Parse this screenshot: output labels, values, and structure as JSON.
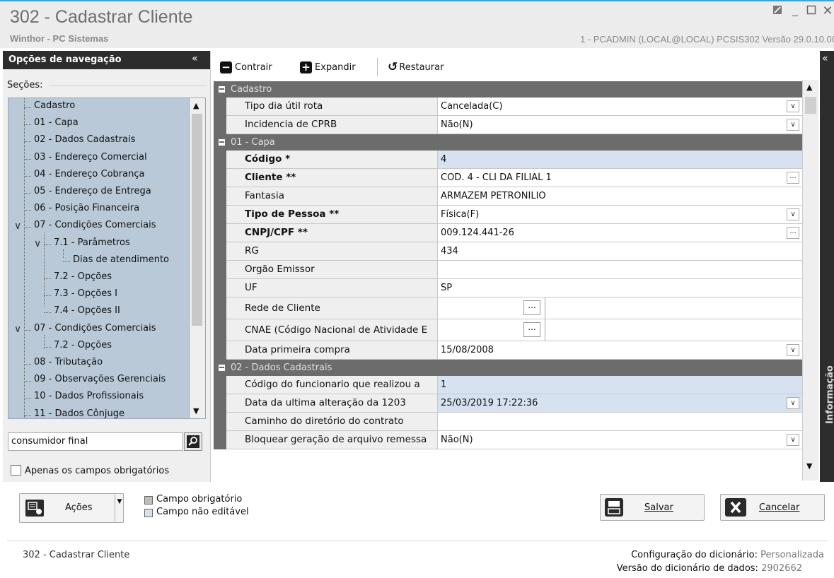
{
  "window": {
    "title": "302 - Cadastrar Cliente",
    "subtitle": "Winthor - PC Sistemas",
    "user_info": "1 - PCADMIN (LOCAL@LOCAL)   PCSIS302  Versão  29.0.10.00"
  },
  "nav": {
    "header": "Opções de navegação",
    "collapse_glyph": "«",
    "sections_label": "Seções:",
    "tree": [
      {
        "label": "Cadastro",
        "level": 0,
        "expander": ""
      },
      {
        "label": "01 - Capa",
        "level": 0,
        "expander": ""
      },
      {
        "label": "02 - Dados Cadastrais",
        "level": 0,
        "expander": ""
      },
      {
        "label": "03 - Endereço Comercial",
        "level": 0,
        "expander": ""
      },
      {
        "label": "04 - Endereço Cobrança",
        "level": 0,
        "expander": ""
      },
      {
        "label": "05 - Endereço de Entrega",
        "level": 0,
        "expander": ""
      },
      {
        "label": "06 - Posição Financeira",
        "level": 0,
        "expander": ""
      },
      {
        "label": "07 - Condições Comerciais",
        "level": 0,
        "expander": "v"
      },
      {
        "label": "7.1 - Parâmetros",
        "level": 1,
        "expander": "v"
      },
      {
        "label": "Dias de atendimento",
        "level": 2,
        "expander": ""
      },
      {
        "label": "7.2 - Opções",
        "level": 1,
        "expander": ""
      },
      {
        "label": "7.3 - Opções I",
        "level": 1,
        "expander": ""
      },
      {
        "label": "7.4 - Opções II",
        "level": 1,
        "expander": ""
      },
      {
        "label": "07 - Condições Comerciais",
        "level": 0,
        "expander": "v"
      },
      {
        "label": "7.2 - Opções",
        "level": 1,
        "expander": ""
      },
      {
        "label": "08 - Tributação",
        "level": 0,
        "expander": ""
      },
      {
        "label": "09 - Observações Gerenciais",
        "level": 0,
        "expander": ""
      },
      {
        "label": "10 - Dados Profissionais",
        "level": 0,
        "expander": ""
      },
      {
        "label": "11 - Dados Cônjuge",
        "level": 0,
        "expander": ""
      }
    ],
    "search_value": "consumidor final",
    "required_only_label": "Apenas os campos obrigatórios"
  },
  "toolbar": {
    "collapse": "Contrair",
    "expand": "Expandir",
    "restore": "Restaurar"
  },
  "right_strip_label": "Informação",
  "grid": [
    {
      "type": "cat",
      "label": "Cadastro"
    },
    {
      "type": "row",
      "label": "Tipo dia útil rota",
      "value": "Cancelada(C)",
      "editor": "dropdown"
    },
    {
      "type": "row",
      "label": "Incidencia de CPRB",
      "value": "Não(N)",
      "editor": "dropdown"
    },
    {
      "type": "cat",
      "label": "01 - Capa"
    },
    {
      "type": "row",
      "label": "Código *",
      "value": "4",
      "bold": true,
      "readonly": true
    },
    {
      "type": "row",
      "label": "Cliente **",
      "value": "COD. 4 - CLI DA FILIAL 1",
      "bold": true,
      "editor": "ellipsis"
    },
    {
      "type": "row",
      "label": "Fantasia",
      "value": "ARMAZEM PETRONILIO"
    },
    {
      "type": "row",
      "label": "Tipo de Pessoa **",
      "value": "Física(F)",
      "bold": true,
      "editor": "dropdown"
    },
    {
      "type": "row",
      "label": "CNPJ/CPF **",
      "value": "009.124.441-26",
      "bold": true,
      "editor": "ellipsis"
    },
    {
      "type": "row",
      "label": "RG",
      "value": "434"
    },
    {
      "type": "row",
      "label": "Orgão Emissor",
      "value": ""
    },
    {
      "type": "row",
      "label": "UF",
      "value": "SP"
    },
    {
      "type": "row",
      "label": "Rede de Cliente",
      "value": "",
      "editor": "lookup",
      "tall": true
    },
    {
      "type": "row",
      "label": "CNAE (Código Nacional de Atividade E",
      "value": "",
      "editor": "lookup",
      "tall": true
    },
    {
      "type": "row",
      "label": "Data primeira compra",
      "value": "15/08/2008",
      "editor": "dropdown"
    },
    {
      "type": "cat",
      "label": "02 - Dados Cadastrais"
    },
    {
      "type": "row",
      "label": "Código do funcionario que realizou a",
      "value": "1",
      "readonly": true
    },
    {
      "type": "row",
      "label": "Data da ultima alteração da 1203",
      "value": "25/03/2019 17:22:36",
      "editor": "dropdown",
      "readonly": true
    },
    {
      "type": "row",
      "label": "Caminho do diretório do contrato",
      "value": ""
    },
    {
      "type": "row",
      "label": "Bloquear geração de arquivo remessa",
      "value": "Não(N)",
      "editor": "dropdown"
    }
  ],
  "bottom": {
    "actions_label": "Ações",
    "legend_required": "Campo obrigatório",
    "legend_readonly": "Campo não editável",
    "save_label": "Salvar",
    "cancel_label": "Cancelar"
  },
  "footer": {
    "left": "302 - Cadastrar Cliente",
    "dict_config_label": "Configuração do dicionário:",
    "dict_config_value": "Personalizada",
    "dict_version_label": "Versão do dicionário de dados:",
    "dict_version_value": "2902662"
  }
}
